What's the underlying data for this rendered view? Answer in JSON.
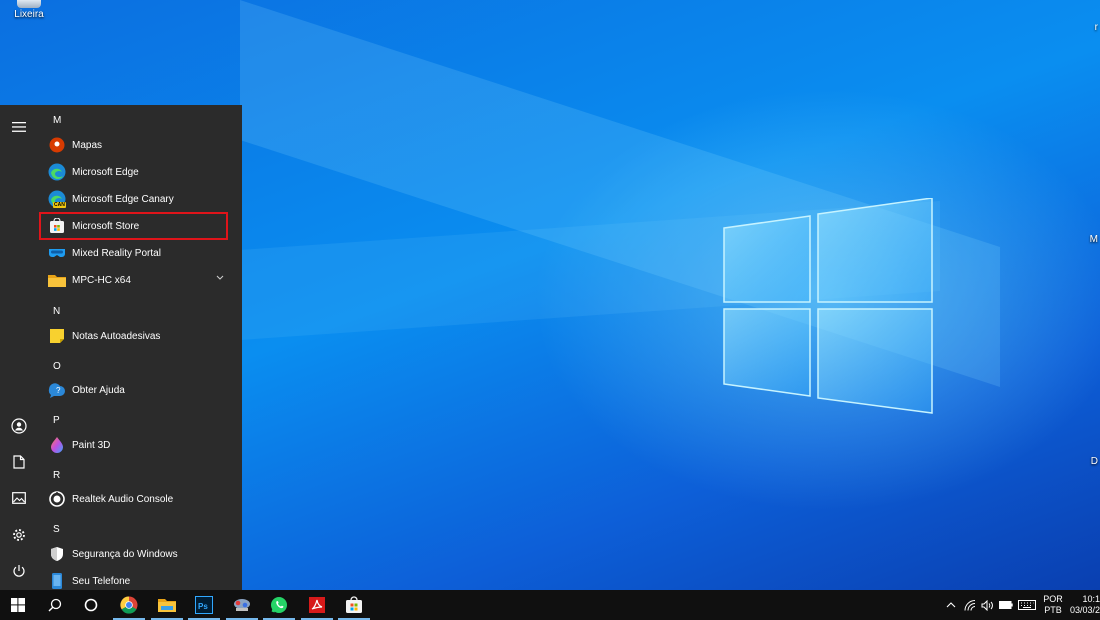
{
  "desktop": {
    "recycle_bin_label": "Lixeira",
    "edge_fragments": [
      "r",
      "M",
      "D"
    ]
  },
  "start_menu": {
    "rail": [
      "menu-icon",
      "user-icon",
      "document-icon",
      "pictures-icon",
      "settings-icon",
      "power-icon"
    ],
    "sections": [
      {
        "letter": "M",
        "apps": [
          {
            "label": "Mapas",
            "icon": "maps-icon"
          },
          {
            "label": "Microsoft Edge",
            "icon": "edge-icon"
          },
          {
            "label": "Microsoft Edge Canary",
            "icon": "edge-canary-icon"
          },
          {
            "label": "Microsoft Store",
            "icon": "store-icon"
          },
          {
            "label": "Mixed Reality Portal",
            "icon": "mixed-reality-icon"
          },
          {
            "label": "MPC-HC x64",
            "icon": "folder-icon"
          }
        ]
      },
      {
        "letter": "N",
        "apps": [
          {
            "label": "Notas Autoadesivas",
            "icon": "sticky-notes-icon"
          }
        ]
      },
      {
        "letter": "O",
        "apps": [
          {
            "label": "Obter Ajuda",
            "icon": "help-icon"
          }
        ]
      },
      {
        "letter": "P",
        "apps": [
          {
            "label": "Paint 3D",
            "icon": "paint3d-icon"
          }
        ]
      },
      {
        "letter": "R",
        "apps": [
          {
            "label": "Realtek Audio Console",
            "icon": "realtek-icon"
          }
        ]
      },
      {
        "letter": "S",
        "apps": [
          {
            "label": "Segurança do Windows",
            "icon": "shield-icon"
          },
          {
            "label": "Seu Telefone",
            "icon": "phone-icon"
          }
        ]
      }
    ],
    "canary_badge": "CAN"
  },
  "taskbar": {
    "language_line1": "POR",
    "language_line2": "PTB",
    "time": "10:1",
    "date": "03/03/2"
  },
  "colors": {
    "highlight_border": "#e0141a",
    "menu_background": "#2b2b2b",
    "taskbar_background": "#101010",
    "active_indicator": "#76b9ed"
  }
}
